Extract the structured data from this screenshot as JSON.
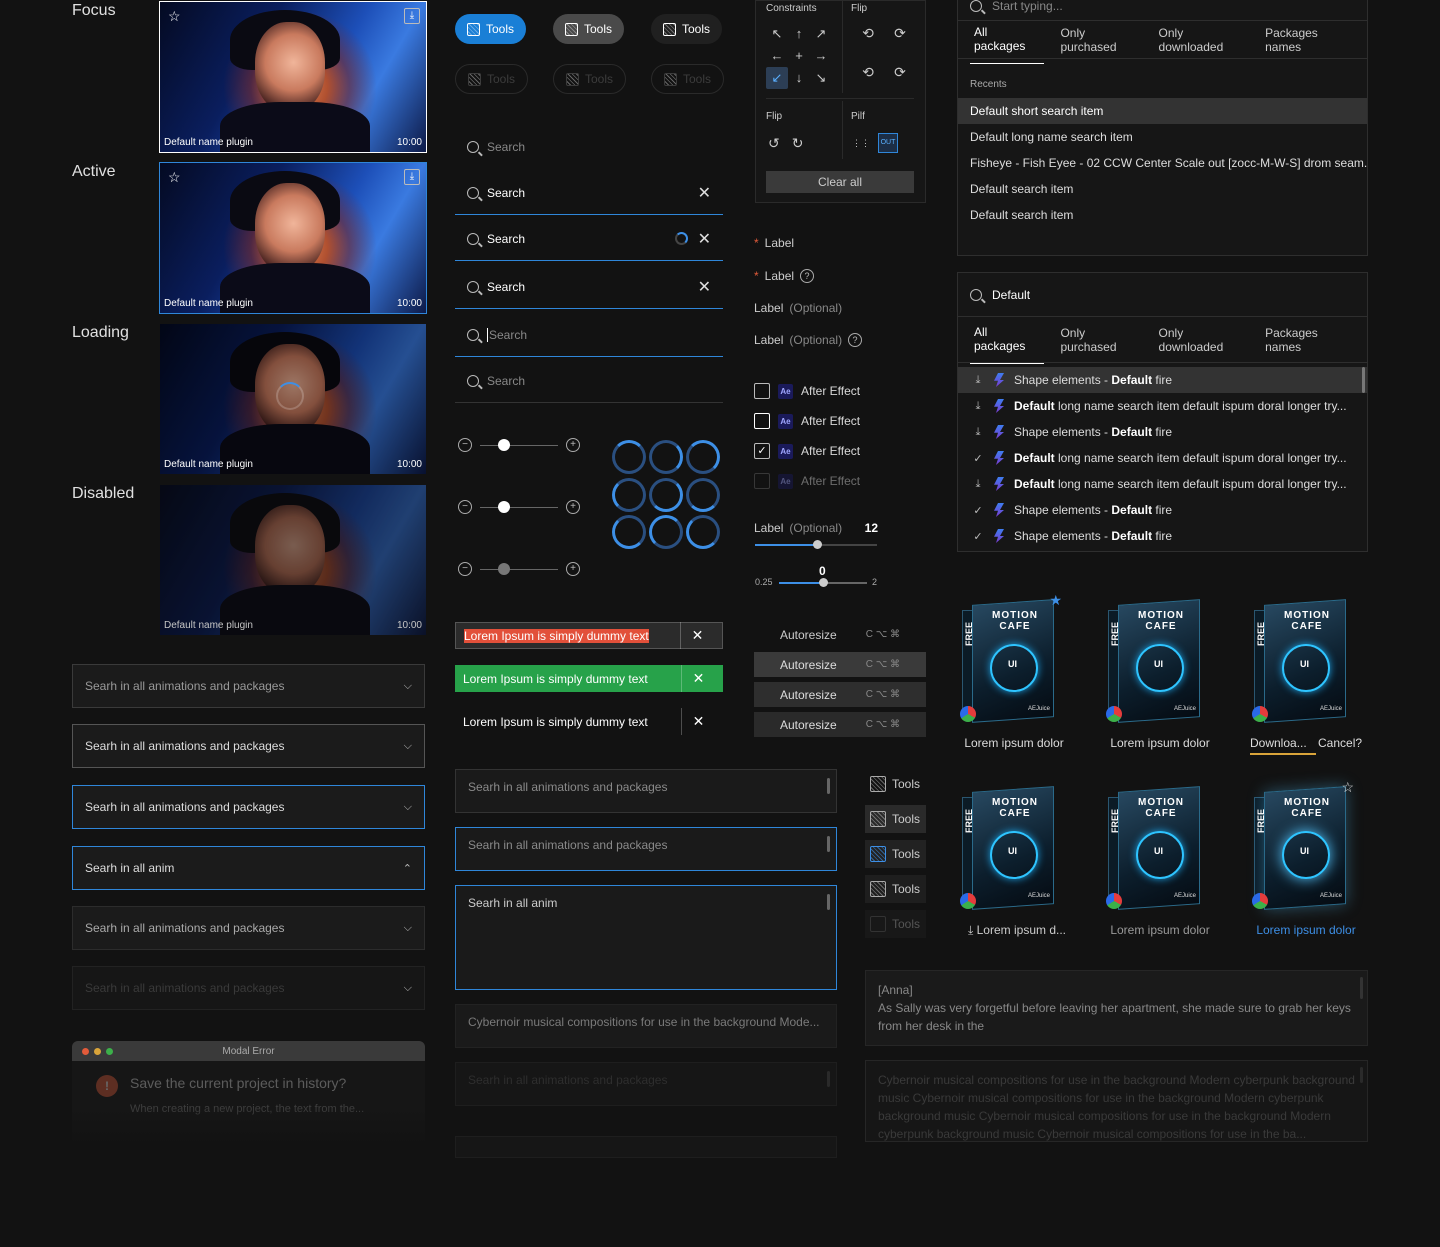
{
  "states": {
    "focus": "Focus",
    "active": "Active",
    "loading": "Loading",
    "disabled": "Disabled"
  },
  "thumb": {
    "name": "Default name plugin",
    "time": "10:00"
  },
  "pills": {
    "label": "Tools"
  },
  "search": {
    "placeholder": "Search",
    "value": "Search"
  },
  "sliders": {
    "label": "Label",
    "optional": "(Optional)",
    "value": "12",
    "range_value": "0",
    "range_min": "0.25",
    "range_max": "2",
    "levels": [
      0.3,
      0.3,
      0.3,
      0.45
    ]
  },
  "toasts": [
    {
      "text": "Lorem Ipsum is simply dummy text",
      "color": "#2b2b2b"
    },
    {
      "text": "Lorem Ipsum is simply dummy text",
      "color": "#e2503a"
    },
    {
      "text": "Lorem Ipsum is simply dummy text",
      "color": "#27a24a"
    }
  ],
  "dropdowns": {
    "full": "Searh in all animations and packages",
    "short": "Searh in all anim"
  },
  "textareas": {
    "full": "Searh in all animations and packages",
    "short": "Searh in all anim",
    "long": "Cybernoir musical compositions for use in the background Mode..."
  },
  "modal": {
    "title": "Modal Error",
    "question": "Save the current project in history?",
    "body": "When creating a new project, the text from the..."
  },
  "constraints": {
    "title": "Constraints",
    "flip": "Flip",
    "flip2": "Flip",
    "pilf": "Pilf",
    "clear": "Clear all",
    "arrows": [
      "↖",
      "↑",
      "↗",
      "←",
      "+",
      "→",
      "↙",
      "↓",
      "↘"
    ]
  },
  "labels": {
    "label": "Label",
    "optional": "(Optional)",
    "required_mark": "*",
    "help": "?"
  },
  "checks": {
    "app": "After Effect",
    "app_short": "Ae",
    "check": "✓"
  },
  "autosize": {
    "label": "Autoresize",
    "keys": "C ⌥ ⌘"
  },
  "tools": {
    "label": "Tools"
  },
  "recents": {
    "placeholder": "Start typing...",
    "heading": "Recents",
    "items": [
      "Default short search item",
      "Default long name search item",
      "Fisheye - Fish Eyee - 02 CCW Center Scale out [zocc-M-W-S] drom seam...",
      "Default search item",
      "Default search item"
    ]
  },
  "tabs": [
    "All packages",
    "Only purchased",
    "Only downloaded",
    "Packages names"
  ],
  "packages": {
    "query": "Default",
    "items": [
      {
        "status": "⤓",
        "pre": "Shape elements - ",
        "bold": "Default",
        " post": " fire"
      },
      {
        "status": "⤓",
        "pre": "",
        "bold": "Default",
        "post": " long name search item default ispum doral longer try..."
      },
      {
        "status": "⤓",
        "pre": "Shape elements - ",
        "bold": "Default",
        "post": " fire"
      },
      {
        "status": "✓",
        "pre": "",
        "bold": "Default",
        "post": " long name search item default ispum doral longer try..."
      },
      {
        "status": "⤓",
        "pre": "",
        "bold": "Default",
        "post": " long name search item default ispum doral longer try..."
      },
      {
        "status": "✓",
        "pre": "Shape elements - ",
        "bold": "Default",
        "post": " fire"
      },
      {
        "status": "✓",
        "pre": "Shape elements - ",
        "bold": "Default",
        "post": " fire"
      }
    ]
  },
  "cards": {
    "title_line1": "MOTION",
    "title_line2": "CAFE",
    "free": "FREE",
    "brand": "AEJuice",
    "caption": "Lorem ipsum dolor",
    "caption_trunc": "Lorem ipsum d...",
    "downloading": "Downloa...",
    "cancel": "Cancel?",
    "link_color": "#3d8fe6"
  },
  "chat": {
    "speaker": "[Anna]",
    "text": "As Sally was very forgetful before leaving her apartment, she made sure to grab her keys from her desk in the",
    "disabled_text": "Cybernoir musical compositions for use in the background Modern cyberpunk background music Cybernoir musical compositions for use in the background Modern cyberpunk background music Cybernoir musical compositions for use in the background Modern cyberpunk background music Cybernoir musical compositions for use in the ba..."
  }
}
